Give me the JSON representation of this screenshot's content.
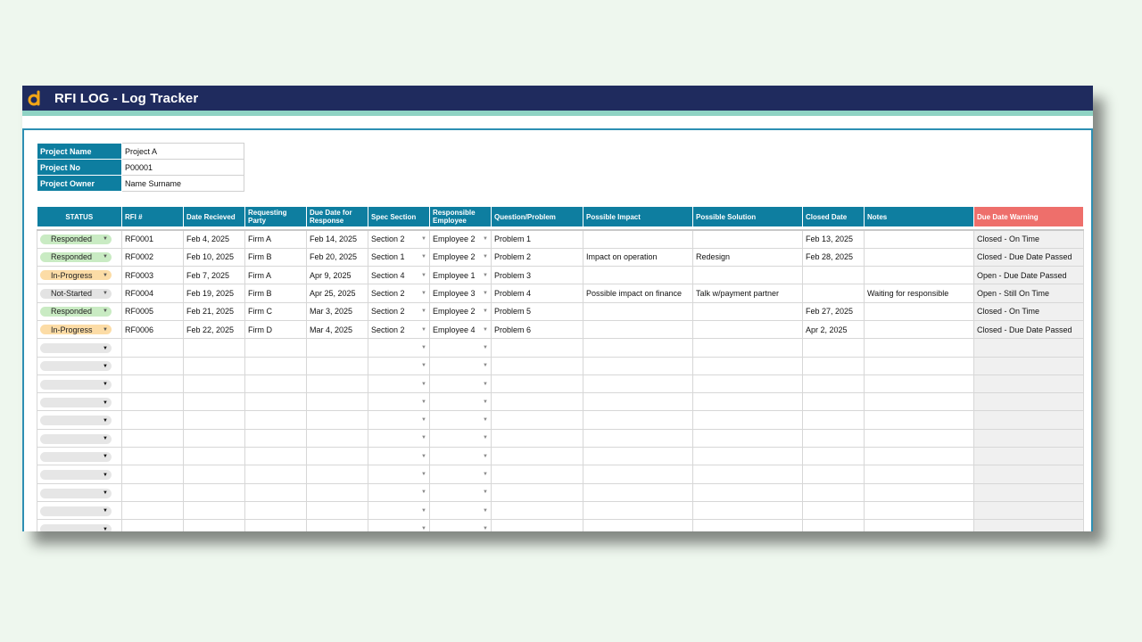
{
  "app": {
    "title": "RFI LOG - Log Tracker",
    "logo_icon": "d-logo-icon",
    "accent": "#1f2b5e",
    "header_color": "#0e7ea0",
    "warning_header_color": "#ee6f6b"
  },
  "project": [
    {
      "label": "Project Name",
      "value": "Project A"
    },
    {
      "label": "Project No",
      "value": "P00001"
    },
    {
      "label": "Project Owner",
      "value": "Name Surname"
    }
  ],
  "columns": {
    "status": "STATUS",
    "rfi": "RFI #",
    "date_received": "Date Recieved",
    "requesting_party": "Requesting Party",
    "due_date": "Due Date for Response",
    "spec_section": "Spec Section",
    "responsible": "Responsible Employee",
    "question": "Question/Problem",
    "impact": "Possible Impact",
    "solution": "Possible Solution",
    "closed": "Closed Date",
    "notes": "Notes",
    "warning": "Due Date Warning"
  },
  "rows": [
    {
      "status": "Responded",
      "status_color": "green",
      "rfi": "RF0001",
      "date_received": "Feb 4, 2025",
      "party": "Firm A",
      "due": "Feb 14, 2025",
      "section": "Section 2",
      "employee": "Employee 2",
      "question": "Problem 1",
      "impact": "",
      "solution": "",
      "closed": "Feb 13, 2025",
      "notes": "",
      "warning": "Closed - On Time",
      "warning_color": "green"
    },
    {
      "status": "Responded",
      "status_color": "green",
      "rfi": "RF0002",
      "date_received": "Feb 10, 2025",
      "party": "Firm B",
      "due": "Feb 20, 2025",
      "section": "Section 1",
      "employee": "Employee 2",
      "question": "Problem 2",
      "impact": "Impact on operation",
      "solution": "Redesign",
      "closed": "Feb 28, 2025",
      "notes": "",
      "warning": "Closed - Due Date Passed",
      "warning_color": "red"
    },
    {
      "status": "In-Progress",
      "status_color": "orange",
      "rfi": "RF0003",
      "date_received": "Feb 7, 2025",
      "party": "Firm A",
      "due": "Apr 9, 2025",
      "section": "Section 4",
      "employee": "Employee 1",
      "question": "Problem 3",
      "impact": "",
      "solution": "",
      "closed": "",
      "notes": "",
      "warning": "Open - Due Date Passed",
      "warning_color": "red"
    },
    {
      "status": "Not-Started",
      "status_color": "gray",
      "rfi": "RF0004",
      "date_received": "Feb 19, 2025",
      "party": "Firm B",
      "due": "Apr 25, 2025",
      "section": "Section 2",
      "employee": "Employee 3",
      "question": "Problem 4",
      "impact": "Possible impact on finance",
      "solution": "Talk w/payment partner",
      "closed": "",
      "notes": "Waiting for responsible",
      "warning": "Open  - Still On Time",
      "warning_color": "green"
    },
    {
      "status": "Responded",
      "status_color": "green",
      "rfi": "RF0005",
      "date_received": "Feb 21, 2025",
      "party": "Firm C",
      "due": "Mar 3, 2025",
      "section": "Section 2",
      "employee": "Employee 2",
      "question": "Problem 5",
      "impact": "",
      "solution": "",
      "closed": "Feb 27, 2025",
      "notes": "",
      "warning": "Closed - On Time",
      "warning_color": "green"
    },
    {
      "status": "In-Progress",
      "status_color": "orange",
      "rfi": "RF0006",
      "date_received": "Feb 22, 2025",
      "party": "Firm D",
      "due": "Mar 4, 2025",
      "section": "Section 2",
      "employee": "Employee 4",
      "question": "Problem 6",
      "impact": "",
      "solution": "",
      "closed": "Apr 2, 2025",
      "notes": "",
      "warning": "Closed - Due Date Passed",
      "warning_color": "red"
    }
  ],
  "empty_rows": 11
}
